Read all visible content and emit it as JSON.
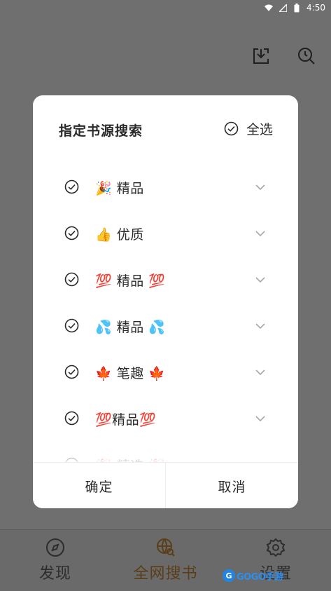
{
  "status_bar": {
    "time": "4:50"
  },
  "bottom_nav": [
    {
      "label": "发现",
      "icon": "compass-icon",
      "active": false
    },
    {
      "label": "全网搜书",
      "icon": "globe-search-icon",
      "active": true
    },
    {
      "label": "设置",
      "icon": "gear-icon",
      "active": false
    }
  ],
  "dialog": {
    "title": "指定书源搜索",
    "select_all_label": "全选",
    "items": [
      {
        "label": "🎉 精品"
      },
      {
        "label": "👍 优质"
      },
      {
        "label": "💯 精品 💯"
      },
      {
        "label": "💦 精品 💦"
      },
      {
        "label": "🍁 笔趣 🍁"
      },
      {
        "label": "💯精品💯"
      },
      {
        "label": "🎉 精选 🎉"
      }
    ],
    "confirm_label": "确定",
    "cancel_label": "取消"
  },
  "watermark": {
    "text": "GOGO手游"
  },
  "colors": {
    "active_nav": "#5b3e18",
    "dim_background": "#6f6f6f",
    "brand_blue": "#1f86e6"
  }
}
